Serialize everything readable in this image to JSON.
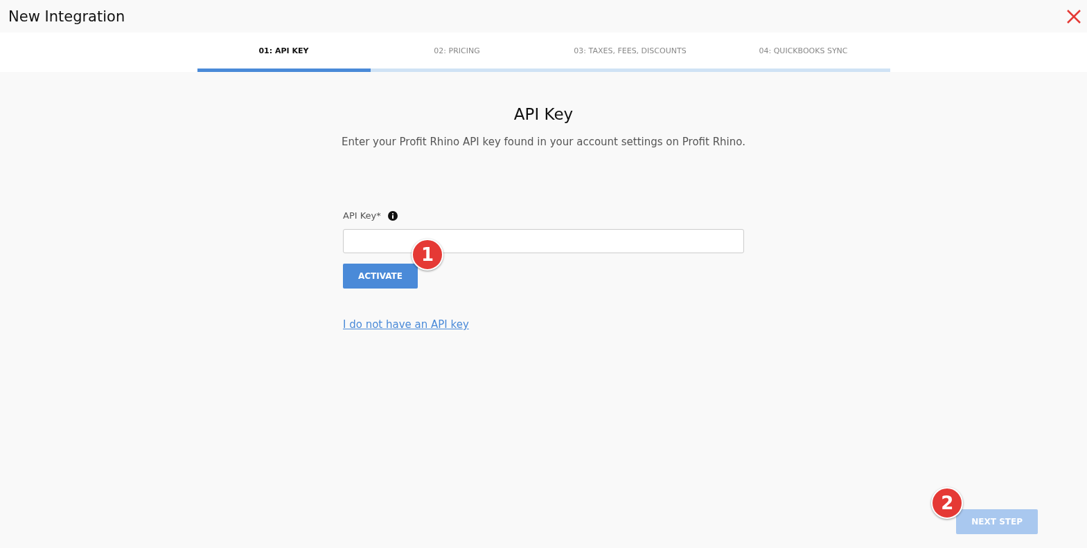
{
  "window": {
    "title": "New Integration"
  },
  "tabs": [
    {
      "label": "01: API KEY",
      "selected": true
    },
    {
      "label": "02: PRICING",
      "selected": false
    },
    {
      "label": "03: TAXES, FEES, DISCOUNTS",
      "selected": false
    },
    {
      "label": "04: QUICKBOOKS SYNC",
      "selected": false
    }
  ],
  "form": {
    "heading": "API Key",
    "description": "Enter your Profit Rhino API key found in your account settings on Profit Rhino.",
    "field_label": "API Key*",
    "activate_button": "ACTIVATE",
    "link": "I do not have an API key"
  },
  "markers": [
    {
      "label": "1"
    },
    {
      "label": "2"
    }
  ],
  "next_button": {
    "label": "NEXT STEP",
    "disabled": true
  }
}
